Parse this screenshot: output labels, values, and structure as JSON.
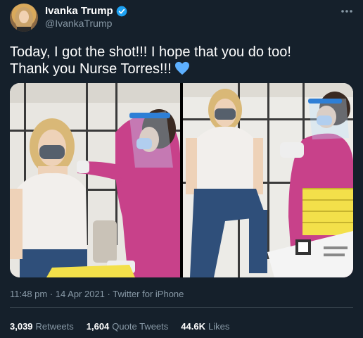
{
  "author": {
    "name": "Ivanka Trump",
    "handle": "@IvankaTrump",
    "verified_icon": "verified-badge-icon",
    "more_icon": "more-options-icon"
  },
  "tweet": {
    "line1": "Today, I got the shot!!! I hope that you do too!",
    "line2": "Thank you Nurse Torres!!!",
    "emoji": "blue-heart-icon"
  },
  "meta": {
    "text": "11:48 pm · 14 Apr 2021 · Twitter for iPhone"
  },
  "stats": {
    "retweets": "3,039",
    "retweets_label": "Retweets",
    "quote_tweets": "1,604",
    "quote_tweets_label": "Quote Tweets",
    "likes": "44.6K",
    "likes_label": "Likes"
  },
  "colors": {
    "background": "#15202b",
    "muted": "#8899a6",
    "verified": "#1da1f2",
    "heart": "#5db0ff"
  }
}
